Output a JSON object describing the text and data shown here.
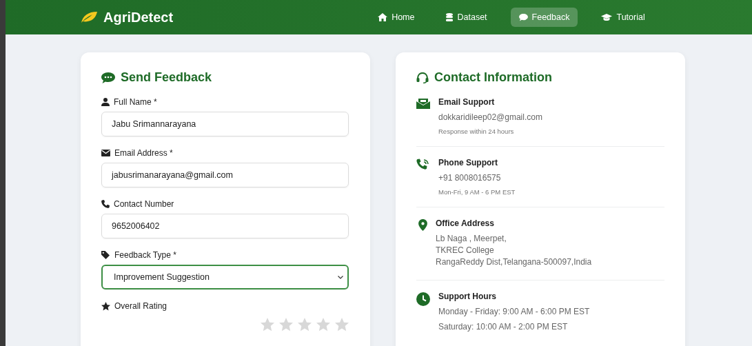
{
  "brand": "AgriDetect",
  "nav": [
    {
      "label": "Home",
      "selected": false
    },
    {
      "label": "Dataset",
      "selected": false
    },
    {
      "label": "Feedback",
      "selected": true
    },
    {
      "label": "Tutorial",
      "selected": false
    }
  ],
  "feedback": {
    "title": "Send Feedback",
    "fields": [
      {
        "kind": "input",
        "label": "Full Name *",
        "value": "Jabu Srimannarayana"
      },
      {
        "kind": "input",
        "label": "Email Address *",
        "value": "jabusrimanarayana@gmail.com"
      },
      {
        "kind": "input",
        "label": "Contact Number",
        "value": "9652006402"
      },
      {
        "kind": "select",
        "label": "Feedback Type *",
        "value": "Improvement Suggestion"
      }
    ],
    "rating": {
      "label": "Overall Rating",
      "stars": 0
    }
  },
  "contact": {
    "title": "Contact Information",
    "items": [
      {
        "title": "Email Support",
        "lines": [
          "dokkaridileep02@gmail.com"
        ],
        "note": "Response within 24 hours"
      },
      {
        "title": "Phone Support",
        "lines": [
          "+91 8008016575"
        ],
        "note": "Mon-Fri, 9 AM - 6 PM EST"
      },
      {
        "title": "Office Address",
        "lines": [
          "Lb Naga , Meerpet,",
          "TKREC College",
          "RangaReddy Dist,Telangana-500097,India"
        ]
      },
      {
        "title": "Support Hours",
        "lines": [
          "Monday - Friday: 9:00 AM - 6:00 PM EST",
          "Saturday: 10:00 AM - 2:00 PM EST"
        ]
      }
    ]
  }
}
